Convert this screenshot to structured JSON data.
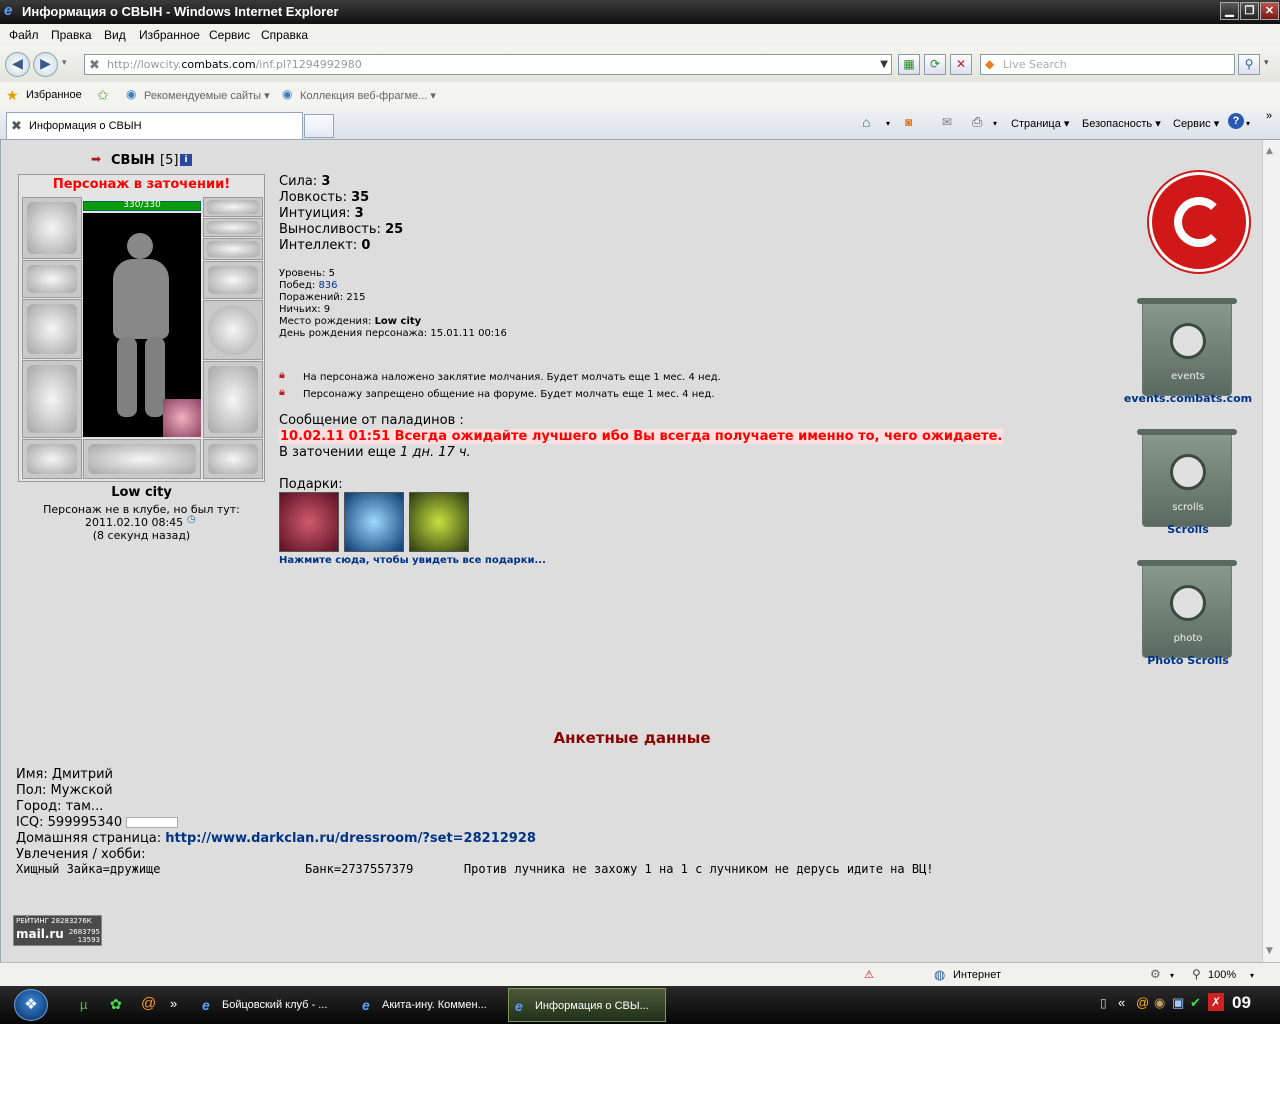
{
  "window": {
    "title": "Информация о СВЫН - Windows Internet Explorer"
  },
  "menu": [
    "Файл",
    "Правка",
    "Вид",
    "Избранное",
    "Сервис",
    "Справка"
  ],
  "address": {
    "prefix": "http://lowcity.",
    "domain": "combats.com",
    "path": "/inf.pl?1294992980"
  },
  "search": {
    "placeholder": "Live Search"
  },
  "favorites": {
    "label": "Избранное",
    "suggested": "Рекомендуемые сайты ▾",
    "slices": "Коллекция веб-фрагме... ▾"
  },
  "tab": {
    "title": "Информация о СВЫН"
  },
  "commands": {
    "page": "Страница ▾",
    "safety": "Безопасность ▾",
    "tools": "Сервис ▾"
  },
  "profile": {
    "name": "СВЫН",
    "level_tag": "[5]",
    "jail_banner": "Персонаж в заточении!",
    "hp": "330/330",
    "city": "Low city",
    "not_in_club": "Персонаж не в клубе, но был тут:",
    "last_seen": "2011.02.10 08:45",
    "ago": "(8 секунд назад)"
  },
  "stats": [
    {
      "label": "Сила:",
      "value": "3"
    },
    {
      "label": "Ловкость:",
      "value": "35"
    },
    {
      "label": "Интуиция:",
      "value": "3"
    },
    {
      "label": "Выносливость:",
      "value": "25"
    },
    {
      "label": "Интеллект:",
      "value": "0"
    }
  ],
  "info": {
    "level_label": "Уровень:",
    "level": "5",
    "wins_label": "Побед:",
    "wins": "836",
    "losses_label": "Поражений:",
    "losses": "215",
    "draws_label": "Ничьих:",
    "draws": "9",
    "birthplace_label": "Место рождения:",
    "birthplace": "Low city",
    "birthday_label": "День рождения персонажа:",
    "birthday": "15.01.11 00:16"
  },
  "notices": {
    "silence": "На персонажа наложено заклятие молчания. Будет молчать еще 1 мес. 4 нед.",
    "forum": "Персонажу запрещено общение на форуме. Будет молчать еще 1 мес. 4 нед."
  },
  "paladins": {
    "header": "Сообщение от паладинов :",
    "message": "10.02.11 01:51 Всегда ожидайте лучшего ибо Вы всегда получаете именно то, чего ожидаете.",
    "jail_prefix": "В заточении еще",
    "jail_left": "1 дн. 17 ч."
  },
  "gifts": {
    "label": "Подарки:",
    "view_all": "Нажмите сюда, чтобы увидеть все подарки..."
  },
  "sidebar": {
    "events_inner": "events",
    "events_label": "events.combats.com",
    "scrolls_inner": "scrolls",
    "scrolls_label": "Scrolls",
    "photo_inner": "photo",
    "photo_label": "Photo Scrolls"
  },
  "anketa": {
    "title": "Анкетные данные",
    "name": "Имя: Дмитрий",
    "gender": "Пол: Мужской",
    "city": "Город: там...",
    "icq": "ICQ: 599995340",
    "home_label": "Домашняя страница:",
    "home_url": "http://www.darkclan.ru/dressroom/?set=28212928",
    "hobby_label": "Увлечения / хобби:",
    "hobby_text": "Хищный Зайка=дружище                    Банк=2737557379       Против лучника не захожу 1 на 1 с лучником не дерусь идите на ВЦ!"
  },
  "counter": {
    "line1": "РЕЙТИНГ 28283276К",
    "brand": "mail.ru",
    "n1": "2683795",
    "n2": "13593"
  },
  "status": {
    "zone": "Интернет",
    "zoom": "100%"
  },
  "taskbar": {
    "tasks": [
      "Бойцовский клуб - ...",
      "Акита-ину. Коммен...",
      "Информация о СВЫ..."
    ],
    "clock": "09"
  },
  "colors": {
    "jail_red": "#ff0000",
    "link_blue": "#003388",
    "anketa_title": "#8b0000",
    "paladin_bg": "#ffe0e0"
  }
}
